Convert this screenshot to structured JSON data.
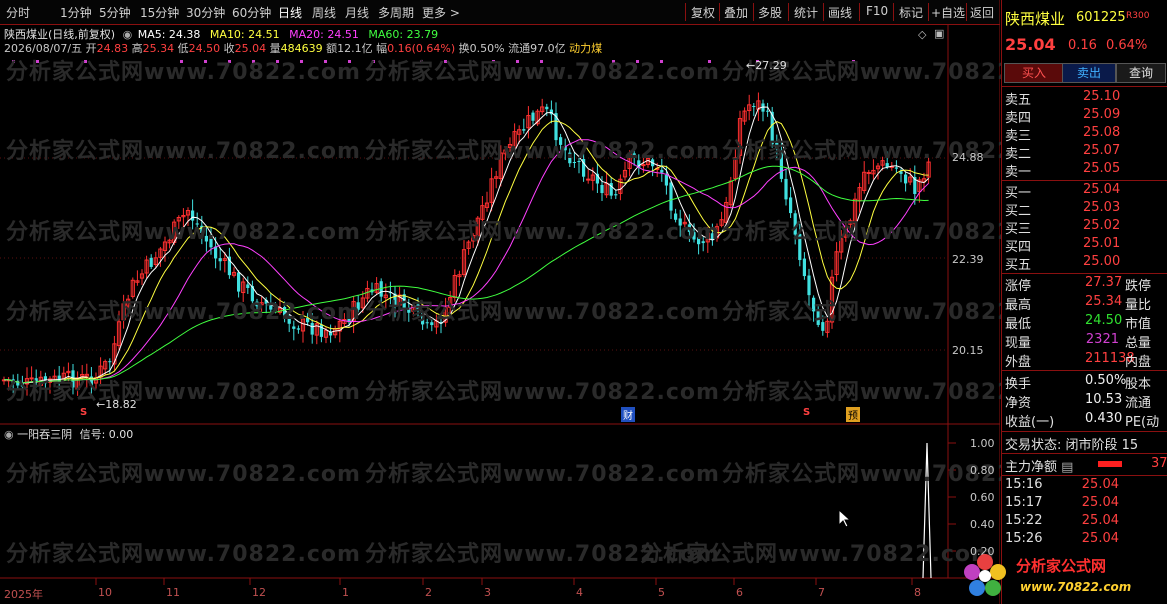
{
  "toolbar": {
    "periods": [
      "分时",
      "1分钟",
      "5分钟",
      "15分钟",
      "30分钟",
      "60分钟",
      "日线",
      "周线",
      "月线",
      "多周期",
      "更多 >"
    ],
    "active_period": "日线",
    "buttons": [
      "复权",
      "叠加",
      "多股",
      "统计",
      "画线",
      "F10",
      "标记",
      "+自选",
      "返回"
    ]
  },
  "main_chart": {
    "title": "陕西煤业(日线,前复权)",
    "ma": [
      {
        "label": "MA5: 24.38",
        "color": "#ffffff"
      },
      {
        "label": "MA10: 24.51",
        "color": "#ffff40"
      },
      {
        "label": "MA20: 24.51",
        "color": "#ff40ff"
      },
      {
        "label": "MA60: 23.79",
        "color": "#40ff40"
      }
    ],
    "info": {
      "date": "2026/08/07/五",
      "open_label": "开",
      "open": "24.83",
      "high_label": "高",
      "high": "25.34",
      "low_label": "低",
      "low": "24.50",
      "close_label": "收",
      "close": "25.04",
      "vol_label": "量",
      "vol": "484639",
      "amount_label": "额",
      "amount": "12.1亿",
      "change_label": "幅",
      "change": "0.16(0.64%)",
      "turnover": "换0.50%",
      "float": "流通97.0亿",
      "concept": "动力煤"
    },
    "price_axis": [
      "24.88",
      "22.39",
      "20.15"
    ],
    "annotations": {
      "high_mark": "27.29",
      "low_mark": "18.82"
    },
    "markers": [
      "S",
      "财",
      "S",
      "预"
    ],
    "watermark": "分析家公式网www.70822.com"
  },
  "indicator": {
    "title": "一阳吞三阴",
    "signal": "信号: 0.00",
    "axis": [
      "1.00",
      "0.80",
      "0.60",
      "0.40",
      "0.20"
    ]
  },
  "x_axis": [
    "2025年",
    "10",
    "11",
    "12",
    "1",
    "2",
    "3",
    "4",
    "5",
    "6",
    "7",
    "8"
  ],
  "right_panel": {
    "name": "陕西煤业",
    "code": "601225",
    "badge": "R300",
    "price": "25.04",
    "change": "0.16",
    "pct": "0.64%",
    "buttons": [
      "买入",
      "卖出",
      "查询"
    ],
    "sell": [
      {
        "label": "卖五",
        "price": "25.10"
      },
      {
        "label": "卖四",
        "price": "25.09"
      },
      {
        "label": "卖三",
        "price": "25.08"
      },
      {
        "label": "卖二",
        "price": "25.07"
      },
      {
        "label": "卖一",
        "price": "25.05"
      }
    ],
    "buy": [
      {
        "label": "买一",
        "price": "25.04"
      },
      {
        "label": "买二",
        "price": "25.03"
      },
      {
        "label": "买三",
        "price": "25.02"
      },
      {
        "label": "买四",
        "price": "25.01"
      },
      {
        "label": "买五",
        "price": "25.00"
      }
    ],
    "stats": [
      {
        "label": "涨停",
        "value": "27.37",
        "tail": "跌停",
        "color": "#ff4040"
      },
      {
        "label": "最高",
        "value": "25.34",
        "tail": "量比",
        "color": "#ff4040"
      },
      {
        "label": "最低",
        "value": "24.50",
        "tail": "市值",
        "color": "#30e030"
      },
      {
        "label": "现量",
        "value": "2321",
        "tail": "总量",
        "color": "#d040d0"
      },
      {
        "label": "外盘",
        "value": "211138",
        "tail": "内盘",
        "color": "#ff4040"
      }
    ],
    "stats2": [
      {
        "label": "换手",
        "value": "0.50%",
        "tail": "股本"
      },
      {
        "label": "净资",
        "value": "10.53",
        "tail": "流通"
      },
      {
        "label": "收益(一)",
        "value": "0.430",
        "tail": "PE(动"
      }
    ],
    "trade_state": "交易状态: 闭市阶段 15",
    "main_net": "主力净额",
    "main_net_value": "37",
    "ticks": [
      {
        "time": "15:16",
        "price": "25.04"
      },
      {
        "time": "15:17",
        "price": "25.04"
      },
      {
        "time": "15:22",
        "price": "25.04"
      },
      {
        "time": "15:26",
        "price": "25.04"
      }
    ],
    "logo_text": "分析家公式网",
    "logo_url": "www.70822.com"
  },
  "colors": {
    "up": "#ff3030",
    "down": "#40e0e0",
    "ma5": "#ffffff",
    "ma10": "#ffff40",
    "ma20": "#ff40ff",
    "ma60": "#40ff40",
    "border": "#8a1010"
  }
}
